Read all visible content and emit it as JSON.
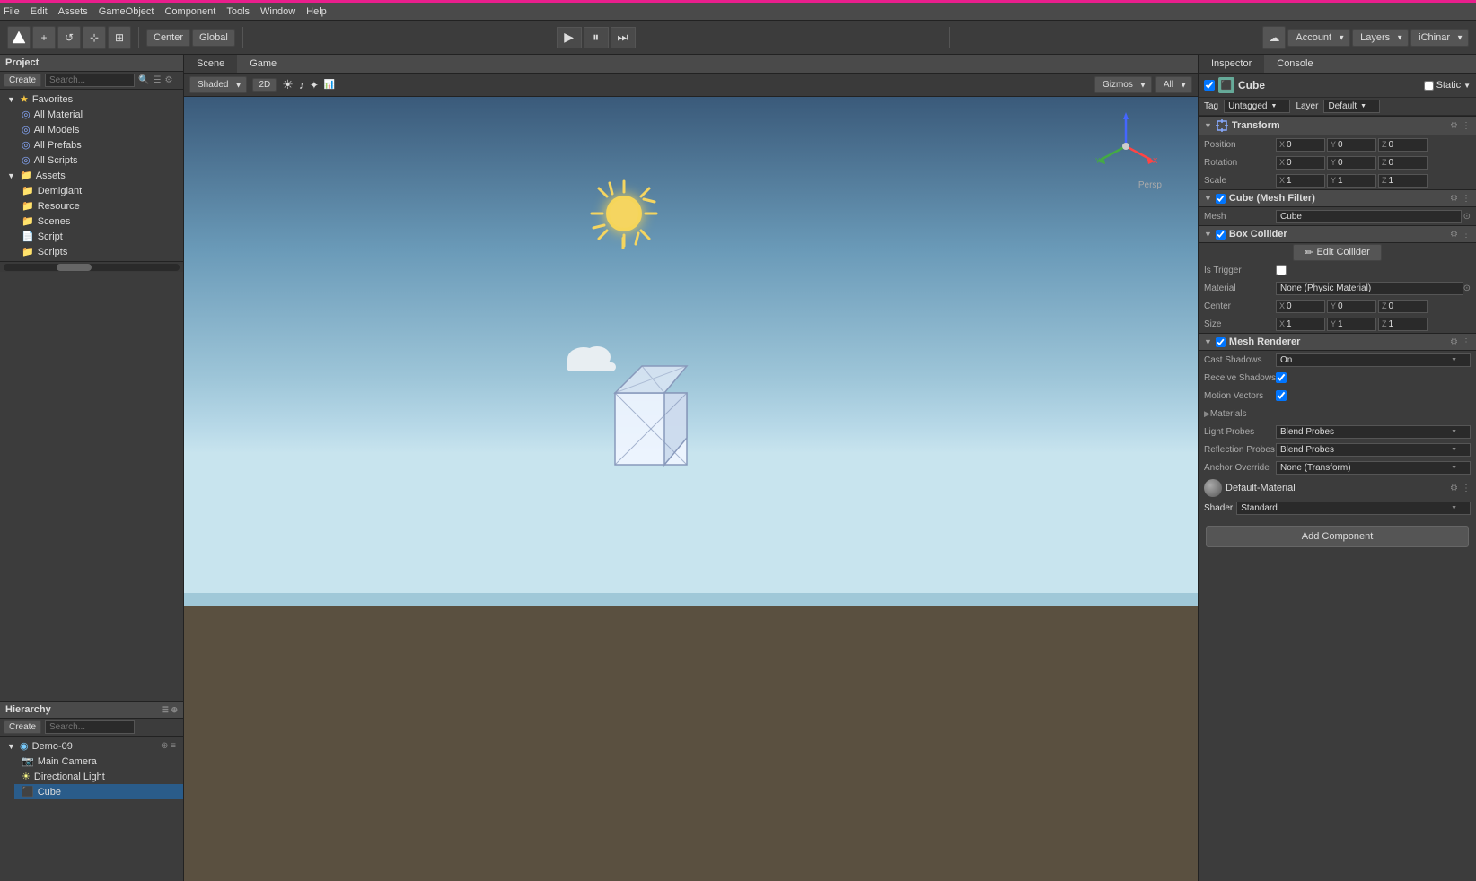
{
  "accent": "#e91e8c",
  "menu": {
    "items": [
      "File",
      "Edit",
      "Assets",
      "GameObject",
      "Component",
      "Tools",
      "Window",
      "Help"
    ]
  },
  "toolbar": {
    "center_btn": "Center",
    "global_btn": "Global",
    "account_btn": "Account",
    "layers_btn": "Layers",
    "ichinar_btn": "iChinar"
  },
  "scene_view": {
    "tab_scene": "Scene",
    "tab_game": "Game",
    "shading_mode": "Shaded",
    "dimension": "2D",
    "gizmos": "Gizmos",
    "filter": "All",
    "persp_label": "Persp"
  },
  "project_panel": {
    "tab": "Project",
    "create_label": "Create",
    "search_placeholder": "",
    "favorites": {
      "label": "Favorites",
      "items": [
        "All Material",
        "All Models",
        "All Prefabs",
        "All Scripts"
      ]
    },
    "assets": {
      "label": "Assets",
      "items": [
        "Demigiant",
        "Resource",
        "Scenes",
        "Script",
        "Scripts"
      ]
    },
    "demigiant_items": [
      "Demigiant",
      "Resource",
      "Scenes",
      "Script",
      "Scripts"
    ]
  },
  "hierarchy_panel": {
    "tab": "Hierarchy",
    "create_label": "Create",
    "scene_name": "Demo-09",
    "items": [
      "Main Camera",
      "Directional Light",
      "Cube"
    ]
  },
  "inspector": {
    "tab_inspector": "Inspector",
    "tab_console": "Console",
    "object_name": "Cube",
    "static_label": "Static",
    "tag_label": "Tag",
    "tag_value": "Untagged",
    "layer_label": "Layer",
    "layer_value": "Default",
    "transform": {
      "title": "Transform",
      "position": {
        "label": "Position",
        "x": "0",
        "y": "0",
        "z": "0"
      },
      "rotation": {
        "label": "Rotation",
        "x": "0",
        "y": "0",
        "z": "0"
      },
      "scale": {
        "label": "Scale",
        "x": "1",
        "y": "1",
        "z": "1"
      }
    },
    "mesh_filter": {
      "title": "Cube (Mesh Filter)",
      "mesh_label": "Mesh",
      "mesh_value": "Cube"
    },
    "box_collider": {
      "title": "Box Collider",
      "edit_btn": "Edit Collider",
      "is_trigger_label": "Is Trigger",
      "material_label": "Material",
      "material_value": "None (Physic Material)",
      "center_label": "Center",
      "center_x": "0",
      "center_y": "0",
      "center_z": "0",
      "size_label": "Size",
      "size_x": "1",
      "size_y": "1",
      "size_z": "1"
    },
    "mesh_renderer": {
      "title": "Mesh Renderer",
      "cast_shadows_label": "Cast Shadows",
      "cast_shadows_value": "On",
      "receive_shadows_label": "Receive Shadows",
      "motion_vectors_label": "Motion Vectors",
      "materials_label": "Materials",
      "light_probes_label": "Light Probes",
      "light_probes_value": "Blend Probes",
      "reflection_probes_label": "Reflection Probes",
      "reflection_probes_value": "Blend Probes",
      "anchor_override_label": "Anchor Override",
      "anchor_override_value": "None (Transform)"
    },
    "material": {
      "name": "Default-Material",
      "shader_label": "Shader",
      "shader_value": "Standard"
    },
    "add_component_btn": "Add Component"
  }
}
